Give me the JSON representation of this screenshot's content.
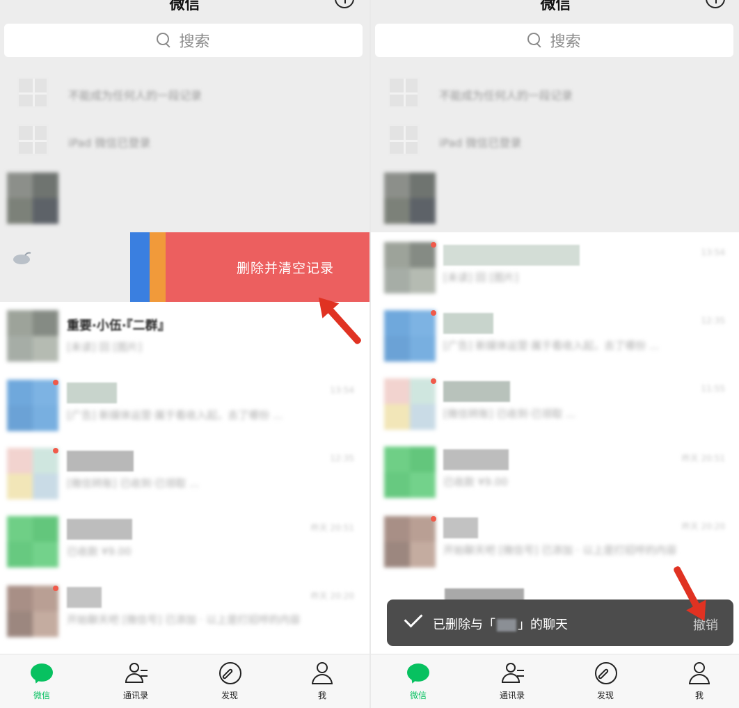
{
  "colors": {
    "wechat_green": "#07c160",
    "delete_red": "#ec5f5f",
    "arrow_red": "#e03222",
    "toast_bg": "#4c4c4c"
  },
  "left": {
    "title": "微信",
    "search_placeholder": "搜索",
    "pinned": [
      {
        "label": "不能成为任何人的一段记录"
      },
      {
        "label": "iPad 微信已登录"
      }
    ],
    "swipe_action": {
      "delete_label": "删除并清空记录"
    },
    "chats": [
      {
        "name": "重要·小伍·『二群』",
        "preview": "[未读] 回 [图片]",
        "time": ""
      },
      {
        "name": "",
        "preview": "[广告] 新媒体运营·属于看收入起，去了哪份 ...",
        "time": "13:54"
      },
      {
        "name": "",
        "preview": "[微信转账] 已收到·已领取 ...",
        "time": "12:35"
      },
      {
        "name": "",
        "preview": "已收款 ¥9.00",
        "time": "昨天 20:51"
      },
      {
        "name": "",
        "preview": "开始聊天吧 [微信号] 已添加 · 以上是打招呼的内容",
        "time": "昨天 20:20"
      }
    ],
    "tabs": [
      {
        "label": "微信",
        "icon": "chat-icon"
      },
      {
        "label": "通讯录",
        "icon": "contacts-icon"
      },
      {
        "label": "发现",
        "icon": "discover-icon"
      },
      {
        "label": "我",
        "icon": "me-icon"
      }
    ]
  },
  "right": {
    "title": "微信",
    "search_placeholder": "搜索",
    "pinned": [
      {
        "label": "不能成为任何人的一段记录"
      },
      {
        "label": "iPad 微信已登录"
      }
    ],
    "chats": [
      {
        "preview": "[未读] 回 [图片]",
        "time": "13:54"
      },
      {
        "preview": "[广告] 新媒体运营·属于看收入起，去了哪份 ...",
        "time": "12:35"
      },
      {
        "preview": "[微信转账] 已收到·已领取 ...",
        "time": "11:55"
      },
      {
        "preview": "已收款 ¥9.00",
        "time": "昨天 20:51"
      },
      {
        "preview": "开始聊天吧 [微信号] 已添加 · 以上是打招呼的内容",
        "time": "昨天 20:20"
      }
    ],
    "toast": {
      "prefix": "已删除与「",
      "suffix": "」的聊天",
      "undo": "撤销"
    },
    "tabs": [
      {
        "label": "微信",
        "icon": "chat-icon"
      },
      {
        "label": "通讯录",
        "icon": "contacts-icon"
      },
      {
        "label": "发现",
        "icon": "discover-icon"
      },
      {
        "label": "我",
        "icon": "me-icon"
      }
    ]
  }
}
